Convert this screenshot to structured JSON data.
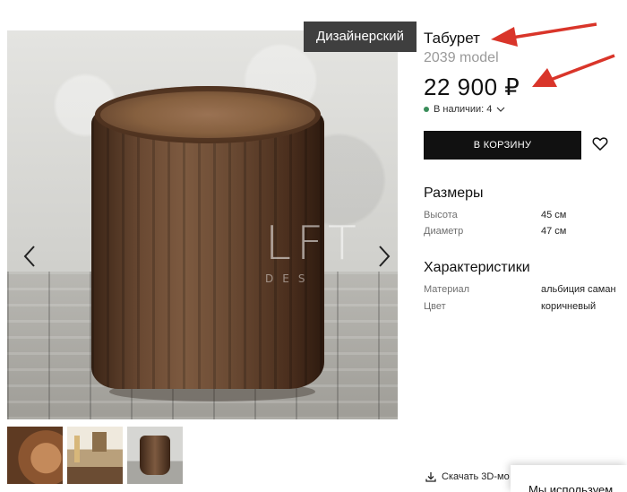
{
  "badge": "Дизайнерский",
  "product": {
    "title": "Табурет",
    "model": "2039 model",
    "price": "22 900 ₽",
    "stock_text": "В наличии: 4"
  },
  "actions": {
    "cart_label": "В КОРЗИНУ",
    "download_label": "Скачать 3D-мо"
  },
  "sizes": {
    "heading": "Размеры",
    "rows": [
      {
        "label": "Высота",
        "value": "45 см"
      },
      {
        "label": "Диаметр",
        "value": "47 см"
      }
    ]
  },
  "specs": {
    "heading": "Характеристики",
    "rows": [
      {
        "label": "Материал",
        "value": "альбиция саман"
      },
      {
        "label": "Цвет",
        "value": "коричневый"
      }
    ]
  },
  "watermark": {
    "logo": "LFT",
    "sub": "DES"
  },
  "cookie_text": "Мы используем",
  "colors": {
    "accent": "#111111",
    "badge_bg": "#3f3f3f",
    "stock_dot": "#3a8d5a",
    "annotation": "#d9352a"
  },
  "icons": [
    "chevron-left-icon",
    "chevron-right-icon",
    "chevron-down-icon",
    "heart-icon",
    "download-icon"
  ]
}
